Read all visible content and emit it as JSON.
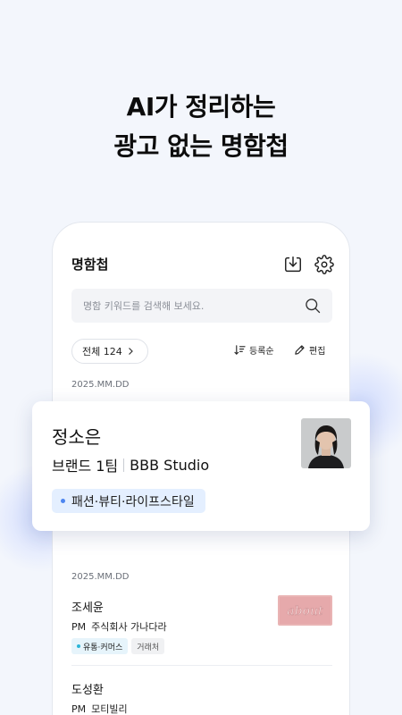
{
  "headline": {
    "line1": "AI가 정리하는",
    "line2": "광고 없는 명함첩"
  },
  "app": {
    "title": "명함첩",
    "search_placeholder": "명함 키워드를 검색해 보세요.",
    "filter_label": "전체 124",
    "sort_label": "등록순",
    "edit_label": "편집"
  },
  "dates": [
    "2025.MM.DD",
    "2025.MM.DD"
  ],
  "featured": {
    "name": "정소은",
    "title": "브랜드 1팀",
    "company": "BBB Studio",
    "tag": "패션·뷰티·라이프스타일"
  },
  "cards": [
    {
      "name": "조세윤",
      "position": "PM",
      "company": "주식회사 가나다라",
      "tags": [
        "유통·커머스",
        "거래처"
      ],
      "thumb_text": "about"
    },
    {
      "name": "도성환",
      "position": "PM",
      "company": "모티빌리"
    }
  ],
  "colors": {
    "background": "#f3f6fc",
    "accent": "#4d86f0",
    "tag_bg": "#e4efff"
  }
}
